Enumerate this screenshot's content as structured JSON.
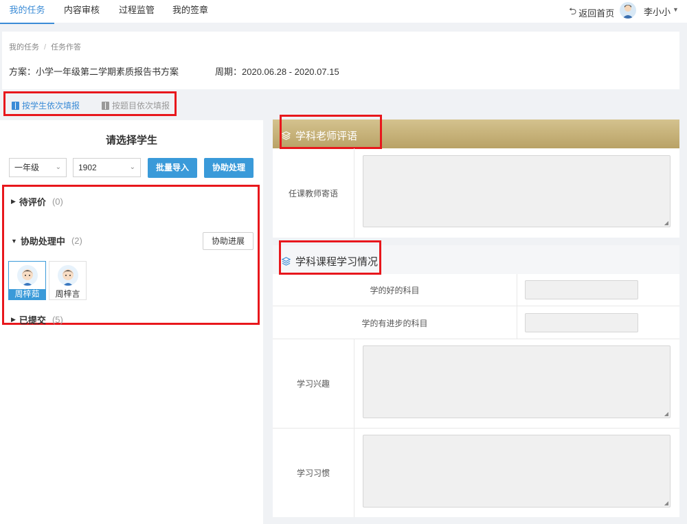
{
  "nav": {
    "tabs": [
      {
        "label": "我的任务",
        "active": true
      },
      {
        "label": "内容审核",
        "active": false
      },
      {
        "label": "过程监管",
        "active": false
      },
      {
        "label": "我的签章",
        "active": false
      }
    ],
    "back_home": "返回首页",
    "user_name": "李小小"
  },
  "info": {
    "breadcrumb": [
      "我的任务",
      "任务作答"
    ],
    "plan": "方案：小学一年级第二学期素质报告书方案",
    "period": "周期：2020.06.28 - 2020.07.15"
  },
  "mode": {
    "by_student": "按学生依次填报",
    "by_question": "按题目依次填报"
  },
  "left": {
    "title": "请选择学生",
    "grade_select": "一年级",
    "class_select": "1902",
    "batch_import": "批量导入",
    "assist_handle": "协助处理",
    "groups": [
      {
        "label": "待评价",
        "count": "(0)"
      },
      {
        "label": "协助处理中",
        "count": "(2)"
      },
      {
        "label": "已提交",
        "count": "(5)"
      }
    ],
    "assist_progress": "协助进展",
    "students": [
      "周梓茹",
      "周梓言"
    ]
  },
  "teacher_comment": {
    "title": "学科老师评语",
    "field_label": "任课教师寄语"
  },
  "course_study": {
    "title": "学科课程学习情况",
    "fields": [
      "学的好的科目",
      "学的有进步的科目",
      "学习兴趣",
      "学习习惯"
    ]
  },
  "colors": {
    "accent": "#3a8bd6",
    "button": "#3a9ad9",
    "gold_header": "#c4af75",
    "highlight_box": "#e8171c"
  }
}
